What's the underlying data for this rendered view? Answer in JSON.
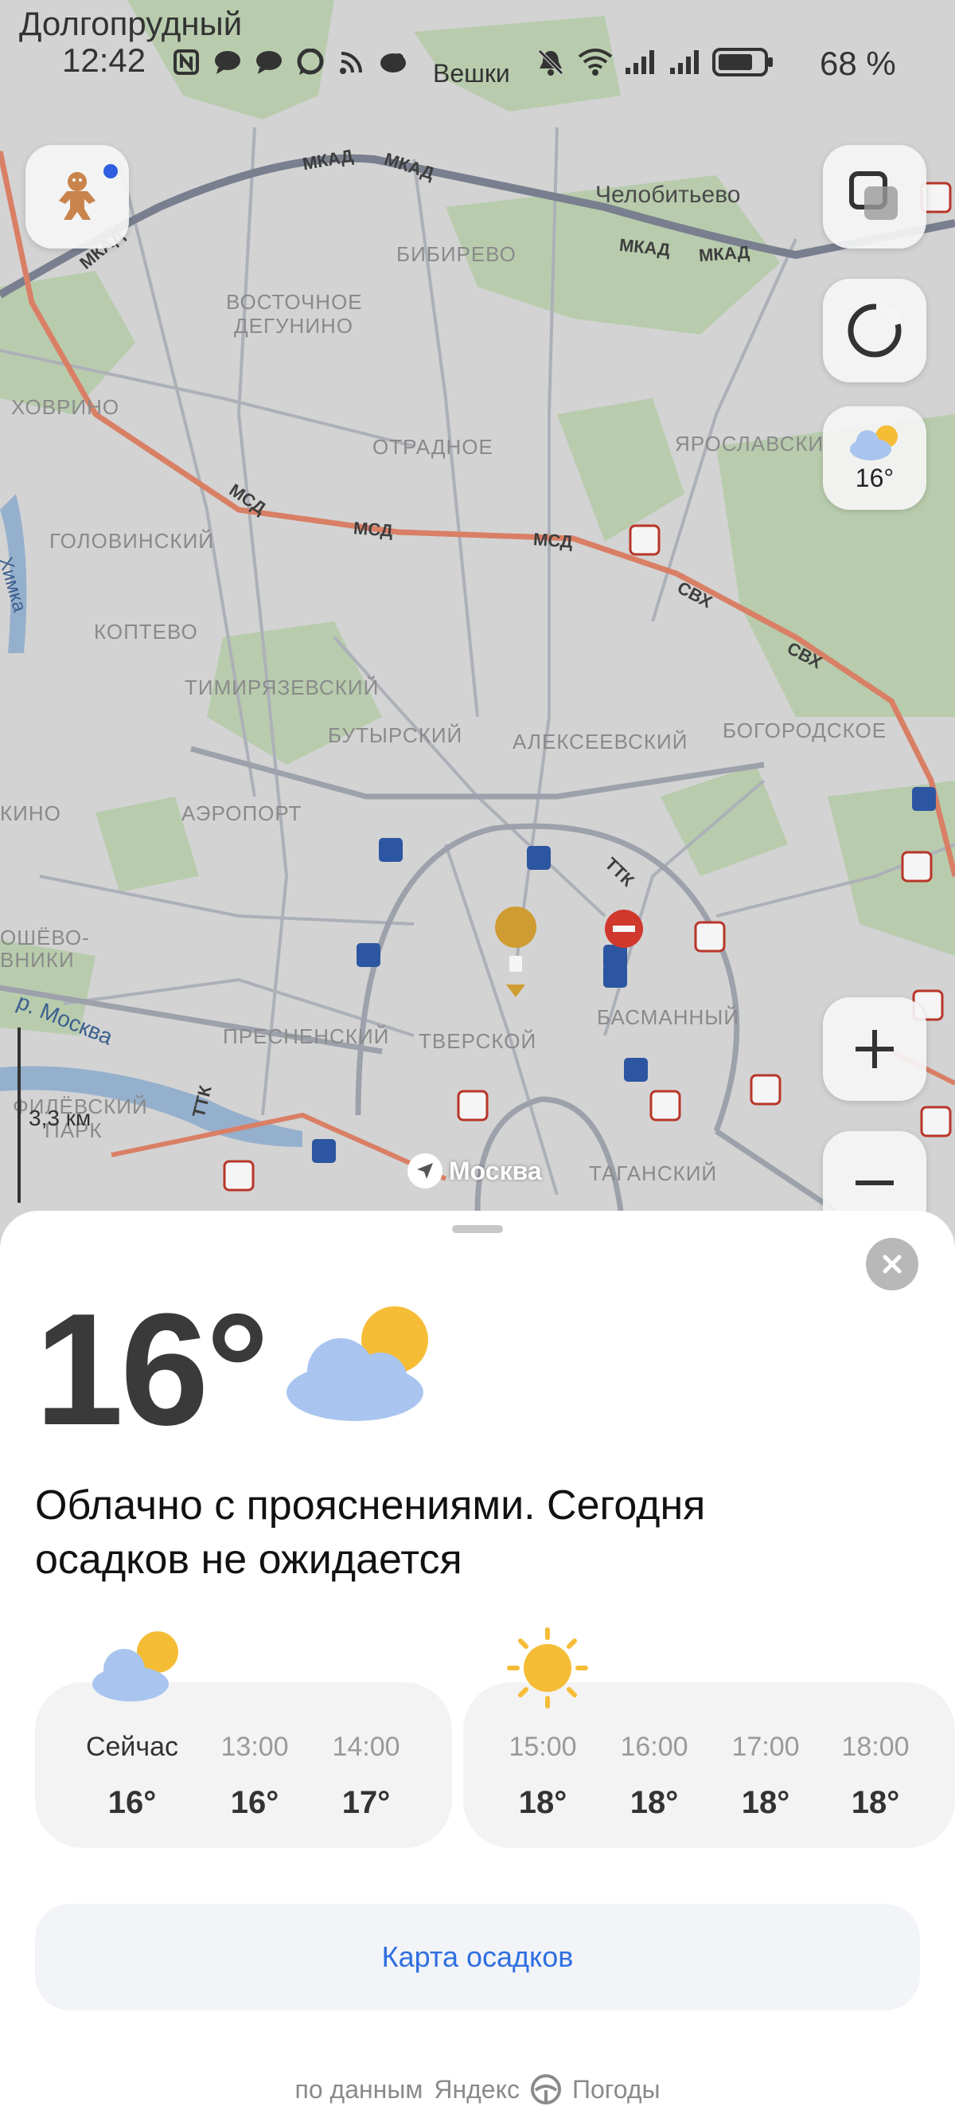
{
  "status_bar": {
    "city": "Долгопрудный",
    "time": "12:42",
    "carrier": "Вешки",
    "battery": "68 %",
    "icons": [
      "nfc-icon",
      "chat-icon",
      "chat-icon",
      "chat-icon",
      "rss-icon",
      "app-icon",
      "mute-icon",
      "wifi-icon",
      "signal-icon",
      "signal-icon",
      "battery-icon"
    ]
  },
  "map": {
    "districts": [
      {
        "id": "chelobitevo",
        "text": "Челобитьево"
      },
      {
        "id": "bibirevo",
        "text": "БИБИРЕВО"
      },
      {
        "id": "vostochnoe",
        "text": "ВОСТОЧНОЕ"
      },
      {
        "id": "degunino",
        "text": "ДЕГУНИНО"
      },
      {
        "id": "khovrino",
        "text": "ХОВРИНО"
      },
      {
        "id": "otradnoe",
        "text": "ОТРАДНОЕ"
      },
      {
        "id": "yaroslavsky",
        "text": "ЯРОСЛАВСКИ"
      },
      {
        "id": "golovinsky",
        "text": "ГОЛОВИНСКИЙ"
      },
      {
        "id": "koptevo",
        "text": "КОПТЕВО"
      },
      {
        "id": "timiryazevsky",
        "text": "ТИМИРЯЗЕВСКИЙ"
      },
      {
        "id": "butyrsky",
        "text": "БУТЫРСКИЙ"
      },
      {
        "id": "alekseevsky",
        "text": "АЛЕКСЕЕВСКИЙ"
      },
      {
        "id": "bogorodskoe",
        "text": "БОГОРОДСКОЕ"
      },
      {
        "id": "khino",
        "text": "КИНО"
      },
      {
        "id": "aeroport",
        "text": "АЭРОПОРТ"
      },
      {
        "id": "shevo",
        "text": "ОШЁВО-"
      },
      {
        "id": "vniki",
        "text": "ВНИКИ"
      },
      {
        "id": "basmanny",
        "text": "БАСМАННЫЙ"
      },
      {
        "id": "presnensky",
        "text": "ПРЕСНЕНСКИЙ"
      },
      {
        "id": "tverskoy",
        "text": "ТВЕРСКОЙ"
      },
      {
        "id": "filevsky",
        "text": "ФИЛЁВСКИЙ"
      },
      {
        "id": "park",
        "text": "ПАРК"
      },
      {
        "id": "tagansky",
        "text": "ТАГАНСКИЙ"
      }
    ],
    "roads": [
      {
        "id": "mkad1",
        "text": "МКАД"
      },
      {
        "id": "mkad2",
        "text": "МКАД"
      },
      {
        "id": "mkad3",
        "text": "МКАД"
      },
      {
        "id": "mkad4",
        "text": "МКАД"
      },
      {
        "id": "mkad5",
        "text": "МКАД"
      },
      {
        "id": "msd1",
        "text": "МСД"
      },
      {
        "id": "msd2",
        "text": "МСД"
      },
      {
        "id": "msd3",
        "text": "МСД"
      },
      {
        "id": "svkh1",
        "text": "СВХ"
      },
      {
        "id": "svkh2",
        "text": "СВХ"
      },
      {
        "id": "ttk1",
        "text": "ТТК"
      },
      {
        "id": "ttk2",
        "text": "ТТК"
      },
      {
        "id": "moskva-river",
        "text": "р. Москва"
      },
      {
        "id": "khimka",
        "text": "Химка"
      }
    ],
    "scale_label": "3,3 км",
    "location_label": "Москва",
    "weather_button_temp": "16°"
  },
  "weather": {
    "temperature": "16°",
    "condition_icon": "partly-cloudy-icon",
    "description": "Облачно с прояснениями. Сегодня осадков не ожидается",
    "hourly_now": [
      {
        "time": "Сейчас",
        "temp": "16°"
      },
      {
        "time": "13:00",
        "temp": "16°"
      },
      {
        "time": "14:00",
        "temp": "17°"
      }
    ],
    "hourly_later": [
      {
        "time": "15:00",
        "temp": "18°"
      },
      {
        "time": "16:00",
        "temp": "18°"
      },
      {
        "time": "17:00",
        "temp": "18°"
      },
      {
        "time": "18:00",
        "temp": "18°"
      }
    ],
    "precip_map_label": "Карта осадков",
    "source_prefix": "по данным",
    "source_brand": "Яндекс",
    "source_suffix": "Погоды"
  },
  "colors": {
    "accent_blue": "#2f6fe0",
    "road_orange": "#e2856a",
    "cloud_blue": "#a9c4ef",
    "sun_yellow": "#f5bc36",
    "park_green": "#a9c79a"
  }
}
